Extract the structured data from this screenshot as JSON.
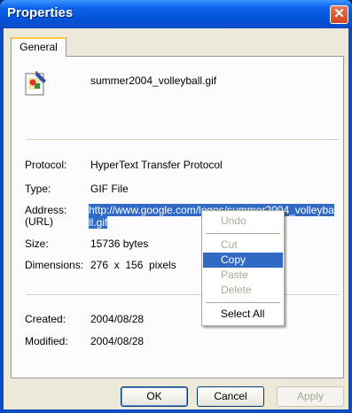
{
  "window": {
    "title": "Properties"
  },
  "tabs": [
    {
      "label": "General"
    }
  ],
  "file": {
    "name": "summer2004_volleyball.gif",
    "icon": "gif-file-icon"
  },
  "properties": {
    "protocol_label": "Protocol:",
    "protocol_value": "HyperText Transfer Protocol",
    "type_label": "Type:",
    "type_value": "GIF File",
    "address_label_1": "Address:",
    "address_label_2": "(URL)",
    "address_value": "http://www.google.com/logos/summer2004_volleyball.gif",
    "size_label": "Size:",
    "size_value": "15736 bytes",
    "dimensions_label": "Dimensions:",
    "dimensions_value": "276  x  156  pixels",
    "created_label": "Created:",
    "created_value": "2004/08/28",
    "modified_label": "Modified:",
    "modified_value": "2004/08/28"
  },
  "buttons": {
    "ok": "OK",
    "cancel": "Cancel",
    "apply": "Apply"
  },
  "context_menu": {
    "undo": "Undo",
    "cut": "Cut",
    "copy": "Copy",
    "paste": "Paste",
    "delete": "Delete",
    "select_all": "Select All"
  },
  "colors": {
    "titlebar": "#0a5fe8",
    "selection": "#316ac5",
    "dialog_bg": "#ece9d8"
  }
}
